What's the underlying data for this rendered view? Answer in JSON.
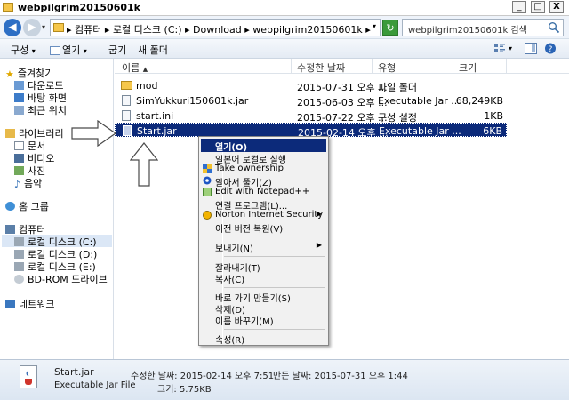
{
  "window": {
    "title": "webpilgrim20150601k",
    "minimize": "_",
    "maximize": "□",
    "close": "X"
  },
  "address": {
    "path_parts": [
      "컴퓨터",
      "로컬 디스크 (C:)",
      "Download",
      "webpilgrim20150601k"
    ],
    "separator": "▸",
    "search_placeholder": "webpilgrim20150601k 검색"
  },
  "toolbar": {
    "organize": "구성",
    "open": "열기",
    "share": "굽기",
    "new_folder": "새 폴더",
    "dropdown": "▾"
  },
  "sidebar": {
    "favorites_title": "즐겨찾기",
    "favorites": [
      "다운로드",
      "바탕 화면",
      "최근 위치"
    ],
    "libraries_title": "라이브러리",
    "libraries": [
      "문서",
      "비디오",
      "사진",
      "음악"
    ],
    "homegroup": "홈 그룹",
    "computer_title": "컴퓨터",
    "drives": [
      "로컬 디스크 (C:)",
      "로컬 디스크 (D:)",
      "로컬 디스크 (E:)",
      "BD-ROM 드라이브"
    ],
    "network": "네트워크"
  },
  "columns": {
    "name": "이름",
    "date": "수정한 날짜",
    "type": "유형",
    "size": "크기"
  },
  "files": [
    {
      "name": "mod",
      "date": "2015-07-31 오후 ...",
      "type": "파일 폴더",
      "size": "",
      "kind": "folder",
      "selected": false
    },
    {
      "name": "SimYukkuri150601k.jar",
      "date": "2015-06-03 오후 ...",
      "type": "Executable Jar ...",
      "size": "68,249KB",
      "kind": "jar",
      "selected": false
    },
    {
      "name": "start.ini",
      "date": "2015-07-22 오후 ...",
      "type": "구성 설정",
      "size": "1KB",
      "kind": "ini",
      "selected": false
    },
    {
      "name": "Start.jar",
      "date": "2015-02-14 오후 ...",
      "type": "Executable Jar ...",
      "size": "6KB",
      "kind": "jar",
      "selected": true
    }
  ],
  "context_menu": {
    "items": [
      {
        "label": "열기(O)",
        "highlighted": true
      },
      {
        "label": "일본어 로컬로 실행"
      },
      {
        "label": "Take ownership"
      },
      {
        "label": "알아서 풀기(Z)"
      },
      {
        "label": "Edit with Notepad++"
      },
      {
        "label": "연결 프로그램(L)..."
      },
      {
        "label": "Norton Internet Security",
        "submenu": true
      },
      {
        "label": "이전 버전 복원(V)"
      },
      {
        "label": "보내기(N)",
        "submenu": true
      },
      {
        "label": "잘라내기(T)"
      },
      {
        "label": "복사(C)"
      },
      {
        "label": "바로 가기 만들기(S)"
      },
      {
        "label": "삭제(D)"
      },
      {
        "label": "이름 바꾸기(M)"
      },
      {
        "label": "속성(R)"
      }
    ],
    "submenu_arrow": "▶"
  },
  "details": {
    "filename": "Start.jar",
    "filetype": "Executable Jar File",
    "modified": "수정한 날짜: 2015-02-14 오후 7:51",
    "created": "만든 날짜: 2015-07-31 오후 1:44",
    "size": "크기: 5.75KB"
  }
}
